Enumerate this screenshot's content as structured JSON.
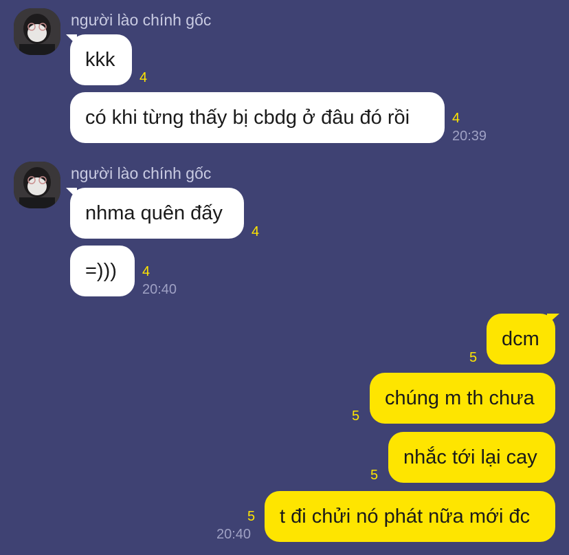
{
  "groups": [
    {
      "sender": "người lào chính gốc",
      "messages": [
        {
          "text": "kkk",
          "unread": "4"
        },
        {
          "text": "có khi từng thấy bị cbdg ở đâu đó rồi",
          "unread": "4",
          "time": "20:39"
        }
      ]
    },
    {
      "sender": "người lào chính gốc",
      "messages": [
        {
          "text": "nhma quên đấy",
          "unread": "4"
        },
        {
          "text": "=)))",
          "unread": "4",
          "time": "20:40"
        }
      ]
    }
  ],
  "outgoing": [
    {
      "text": "dcm",
      "unread": "5"
    },
    {
      "text": "chúng m th chưa",
      "unread": "5"
    },
    {
      "text": "nhắc tới lại cay",
      "unread": "5"
    },
    {
      "text": "t đi chửi nó phát nữa mới đc",
      "unread": "5",
      "time": "20:40"
    }
  ],
  "colors": {
    "background": "#3f4273",
    "incoming_bubble": "#ffffff",
    "outgoing_bubble": "#fee500",
    "unread_count": "#fee500",
    "timestamp": "#9fa1c4"
  }
}
